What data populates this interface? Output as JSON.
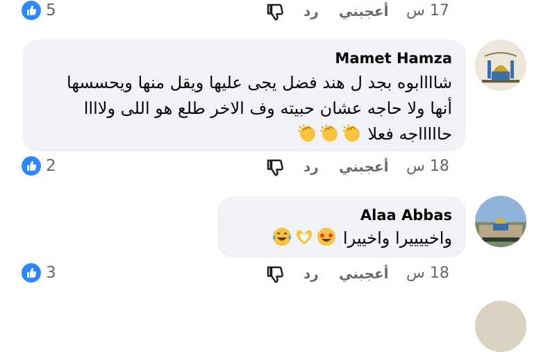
{
  "colors": {
    "accent": "#2d88ff",
    "bubble": "#f0f2f5",
    "meta": "#65676b"
  },
  "actions_top": {
    "like_count": "5",
    "reply": "رد",
    "like": "أعجبني",
    "time": "17 س"
  },
  "comments": [
    {
      "author": "Mamet Hamza",
      "lines": [
        "شاااابوه بجد ل هند فضل يجى عليها ويقل منها ويحسسها",
        "أنها ولا حاجه عشان حبيته وف الاخر طلع هو اللى ولاااا",
        "حاااااجه فعلا"
      ],
      "emojis": [
        "clapping-hands-icon",
        "clapping-hands-icon",
        "clapping-hands-icon"
      ],
      "like_count": "2",
      "reply": "رد",
      "like": "أعجبني",
      "time": "18 س"
    },
    {
      "author": "Alaa Abbas",
      "lines": [
        "واخييييرا واخييرا"
      ],
      "emojis": [
        "star-struck-face-icon",
        "heart-hands-icon",
        "tears-of-joy-face-icon"
      ],
      "like_count": "3",
      "reply": "رد",
      "like": "أعجبني",
      "time": "18 س"
    }
  ]
}
